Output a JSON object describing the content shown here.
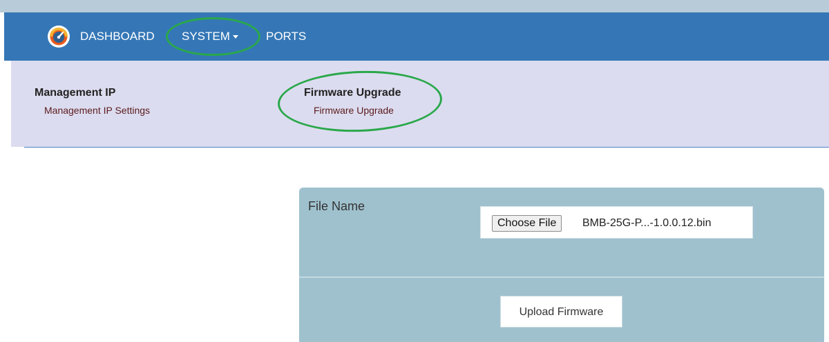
{
  "navbar": {
    "background": "#3577b6",
    "items": [
      {
        "label": "DASHBOARD",
        "icon": "speedometer-logo-icon"
      },
      {
        "label": "SYSTEM",
        "icon": "caret-down-icon"
      },
      {
        "label": "PORTS"
      }
    ]
  },
  "submenu": {
    "background": "#dcdcf0",
    "groups": [
      {
        "heading": "Management IP",
        "link": "Management IP Settings"
      },
      {
        "heading": "Firmware Upgrade",
        "link": "Firmware Upgrade"
      }
    ]
  },
  "highlight_color": "#2aa84a",
  "upload_panel": {
    "background": "#9fc1ce",
    "file_label": "File Name",
    "choose_button": "Choose File",
    "selected_file": "BMB-25G-P...-1.0.0.12.bin",
    "upload_button": "Upload Firmware"
  }
}
